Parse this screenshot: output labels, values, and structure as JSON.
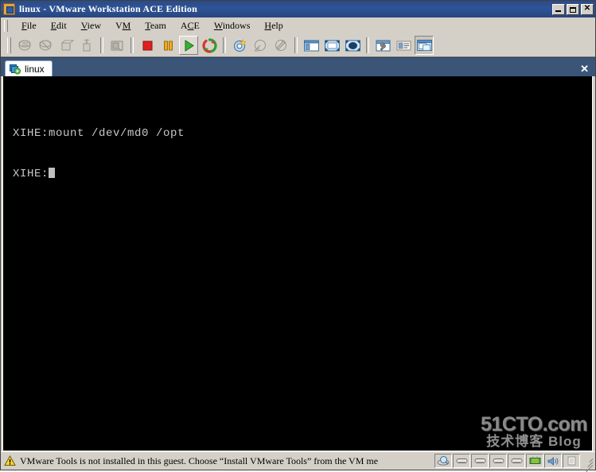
{
  "window": {
    "title": "linux - VMware Workstation ACE Edition",
    "app_icon": "vmware-logo-icon",
    "buttons": {
      "minimize": "minimize-icon",
      "maximize": "maximize-icon",
      "close": "✕"
    }
  },
  "menubar": {
    "items": [
      {
        "label": "File",
        "mnemonic": "F"
      },
      {
        "label": "Edit",
        "mnemonic": "E"
      },
      {
        "label": "View",
        "mnemonic": "V"
      },
      {
        "label": "VM",
        "mnemonic": "M"
      },
      {
        "label": "Team",
        "mnemonic": "T"
      },
      {
        "label": "ACE",
        "mnemonic": "C"
      },
      {
        "label": "Windows",
        "mnemonic": "W"
      },
      {
        "label": "Help",
        "mnemonic": "H"
      }
    ]
  },
  "toolbar": {
    "buttons": [
      {
        "name": "power-on-vm-icon",
        "tooltip": "Power On",
        "state": "disabled"
      },
      {
        "name": "power-off-vm-icon",
        "tooltip": "Power Off",
        "state": "disabled"
      },
      {
        "name": "suspend-vm-icon",
        "tooltip": "Suspend",
        "state": "disabled"
      },
      {
        "name": "reset-vm-icon",
        "tooltip": "Reset",
        "state": "disabled"
      },
      {
        "name": "snapshot-manager-icon",
        "tooltip": "Snapshot Manager",
        "state": "disabled"
      },
      {
        "name": "stop-icon",
        "tooltip": "Stop",
        "state": "normal"
      },
      {
        "name": "pause-icon",
        "tooltip": "Pause",
        "state": "normal"
      },
      {
        "name": "play-icon",
        "tooltip": "Play",
        "state": "hover"
      },
      {
        "name": "revert-snapshot-icon",
        "tooltip": "Revert to Snapshot",
        "state": "normal"
      },
      {
        "name": "take-snapshot-icon",
        "tooltip": "Take Snapshot",
        "state": "normal"
      },
      {
        "name": "revert-icon",
        "tooltip": "Revert",
        "state": "disabled"
      },
      {
        "name": "manage-snapshots-icon",
        "tooltip": "Manage Snapshots",
        "state": "disabled"
      },
      {
        "name": "show-sidebar-icon",
        "tooltip": "Show or Hide Sidebar",
        "state": "normal"
      },
      {
        "name": "quick-switch-icon",
        "tooltip": "Quick Switch",
        "state": "normal"
      },
      {
        "name": "full-screen-icon",
        "tooltip": "Full Screen",
        "state": "normal"
      },
      {
        "name": "vm-settings-icon",
        "tooltip": "VM Settings",
        "state": "normal"
      },
      {
        "name": "summary-view-icon",
        "tooltip": "Summary",
        "state": "normal"
      },
      {
        "name": "console-view-icon",
        "tooltip": "Console View",
        "state": "pressed"
      }
    ]
  },
  "tabs": {
    "items": [
      {
        "label": "linux",
        "icon": "vm-tab-icon",
        "active": true
      }
    ],
    "close_label": "✕"
  },
  "guest": {
    "terminal": {
      "lines": [
        "XIHE:mount /dev/md0 /opt",
        "XIHE:"
      ],
      "prompt": "XIHE:",
      "command": "mount /dev/md0 /opt",
      "cursor_visible": true,
      "fg_color": "#c8c8c8",
      "bg_color": "#000000"
    },
    "watermark": {
      "main": "51CTO.com",
      "sub": "技术博客 Blog"
    }
  },
  "statusbar": {
    "warning_icon": "warning-triangle-icon",
    "message": "VMware Tools is not installed in this guest. Choose “Install VMware Tools” from the VM me",
    "devices": [
      {
        "name": "status-floppy-icon",
        "type": "floppy"
      },
      {
        "name": "status-hdd-1-icon",
        "type": "disk"
      },
      {
        "name": "status-hdd-2-icon",
        "type": "disk"
      },
      {
        "name": "status-hdd-3-icon",
        "type": "disk"
      },
      {
        "name": "status-hdd-4-icon",
        "type": "disk"
      },
      {
        "name": "status-network-icon",
        "type": "network"
      },
      {
        "name": "status-sound-icon",
        "type": "sound"
      },
      {
        "name": "status-printer-icon",
        "type": "printer"
      }
    ]
  },
  "colors": {
    "title_bar": "#2f5497",
    "chrome": "#d4d0c8",
    "tabstrip": "#3b5579",
    "guest_bg": "#000000",
    "terminal_fg": "#c8c8c8",
    "accent_play": "#3cb043",
    "accent_stop": "#e03030",
    "accent_pause": "#f0a020"
  }
}
